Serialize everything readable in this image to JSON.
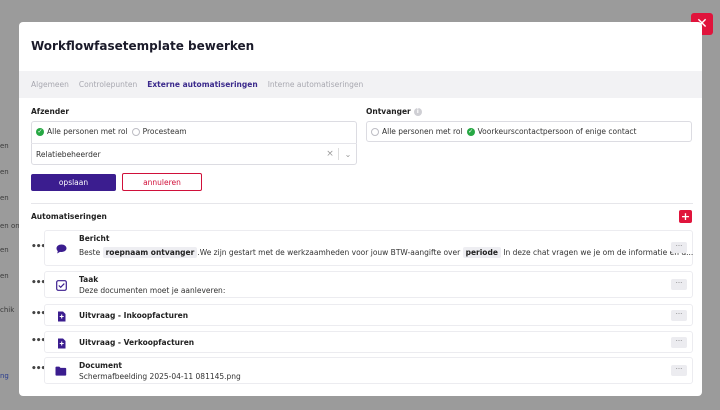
{
  "background": {
    "left_fragments": [
      "en",
      "en",
      "en",
      "en on d",
      "en",
      "en",
      "chik"
    ],
    "bottom_link": "ng"
  },
  "modal": {
    "title": "Workflowfasetemplate bewerken",
    "tabs": [
      {
        "label": "Algemeen",
        "active": false
      },
      {
        "label": "Controlepunten",
        "active": false
      },
      {
        "label": "Externe automatiseringen",
        "active": true
      },
      {
        "label": "Interne automatiseringen",
        "active": false
      }
    ],
    "sender": {
      "label": "Afzender",
      "options": [
        {
          "label": "Alle personen met rol",
          "checked": true
        },
        {
          "label": "Procesteam",
          "checked": false
        }
      ],
      "select_value": "Relatiebeheerder"
    },
    "receiver": {
      "label": "Ontvanger",
      "options": [
        {
          "label": "Alle personen met rol",
          "checked": false
        },
        {
          "label": "Voorkeurscontactpersoon of enige contact",
          "checked": true
        }
      ]
    },
    "buttons": {
      "save": "opslaan",
      "cancel": "annuleren"
    },
    "automations": {
      "label": "Automatiseringen",
      "items": [
        {
          "icon": "chat-bubble-icon",
          "title": "Bericht",
          "sub_parts": [
            "Beste ",
            "roepnaam ontvanger",
            ".We zijn gestart met de werkzaamheden voor jouw BTW-aangifte over ",
            "periode",
            " In deze chat vragen we je om de informatie en d..."
          ]
        },
        {
          "icon": "checkbox-icon",
          "title": "Taak",
          "sub": "Deze documenten moet je aanleveren:"
        },
        {
          "icon": "file-request-icon",
          "title": "Uitvraag - Inkoopfacturen",
          "sub": ""
        },
        {
          "icon": "file-request-icon",
          "title": "Uitvraag - Verkoopfacturen",
          "sub": ""
        },
        {
          "icon": "folder-icon",
          "title": "Document",
          "sub": "Schermafbeelding 2025-04-11 081145.png"
        }
      ]
    }
  },
  "colors": {
    "accent": "#3b1d8f",
    "danger": "#e0143c",
    "success": "#27a844"
  }
}
